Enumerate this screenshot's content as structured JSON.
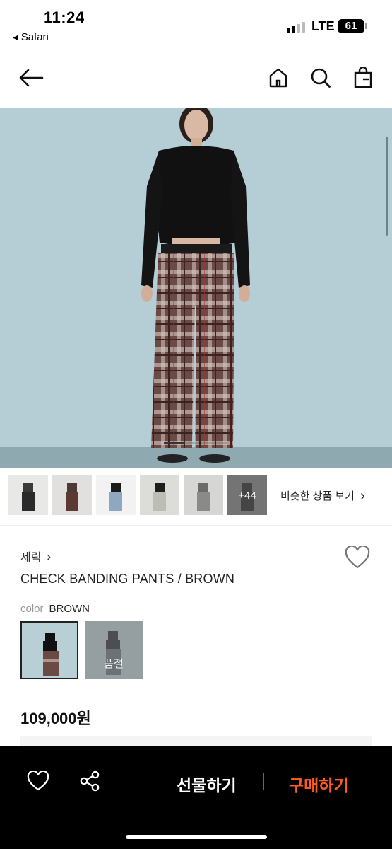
{
  "status_bar": {
    "time": "11:24",
    "back_app": "Safari",
    "network": "LTE",
    "battery": "61"
  },
  "nav": {
    "icons": [
      "back-arrow-icon",
      "home-icon",
      "search-icon",
      "shopping-bag-icon"
    ]
  },
  "gallery": {
    "thumbnails": [
      {
        "pants_color": "#2b2b2b",
        "top_color": "#3a3a3a"
      },
      {
        "pants_color": "#5b3a32",
        "top_color": "#4a3b36"
      },
      {
        "pants_color": "#8fa8c2",
        "top_color": "#1a1a1a"
      },
      {
        "pants_color": "#bdbdb5",
        "top_color": "#1e1e1e"
      },
      {
        "pants_color": "#8a8a88",
        "top_color": "#6b6b6b"
      },
      {
        "pants_color": "#2a2a2a",
        "top_color": "#2a2a2a"
      }
    ],
    "more_count": "+44",
    "similar_label": "비슷한 상품 보기",
    "similar_chevron": "›"
  },
  "product": {
    "brand": "세릭",
    "brand_chevron": "›",
    "name": "CHECK BANDING PANTS / BROWN",
    "color_label": "color",
    "color_value": "BROWN",
    "swatches": [
      {
        "selected": true,
        "sold_out": false
      },
      {
        "selected": false,
        "sold_out": true,
        "sold_out_label": "품절"
      }
    ],
    "price": "109,000원"
  },
  "bottom_bar": {
    "gift_label": "선물하기",
    "buy_label": "구매하기",
    "buy_color": "#ff5a1f",
    "icons": [
      "heart-outline-icon",
      "share-icon"
    ]
  },
  "colors": {
    "hero_background": "#b5cdd4",
    "plaid_base": "#6b4a45",
    "cardigan": "#111111"
  }
}
